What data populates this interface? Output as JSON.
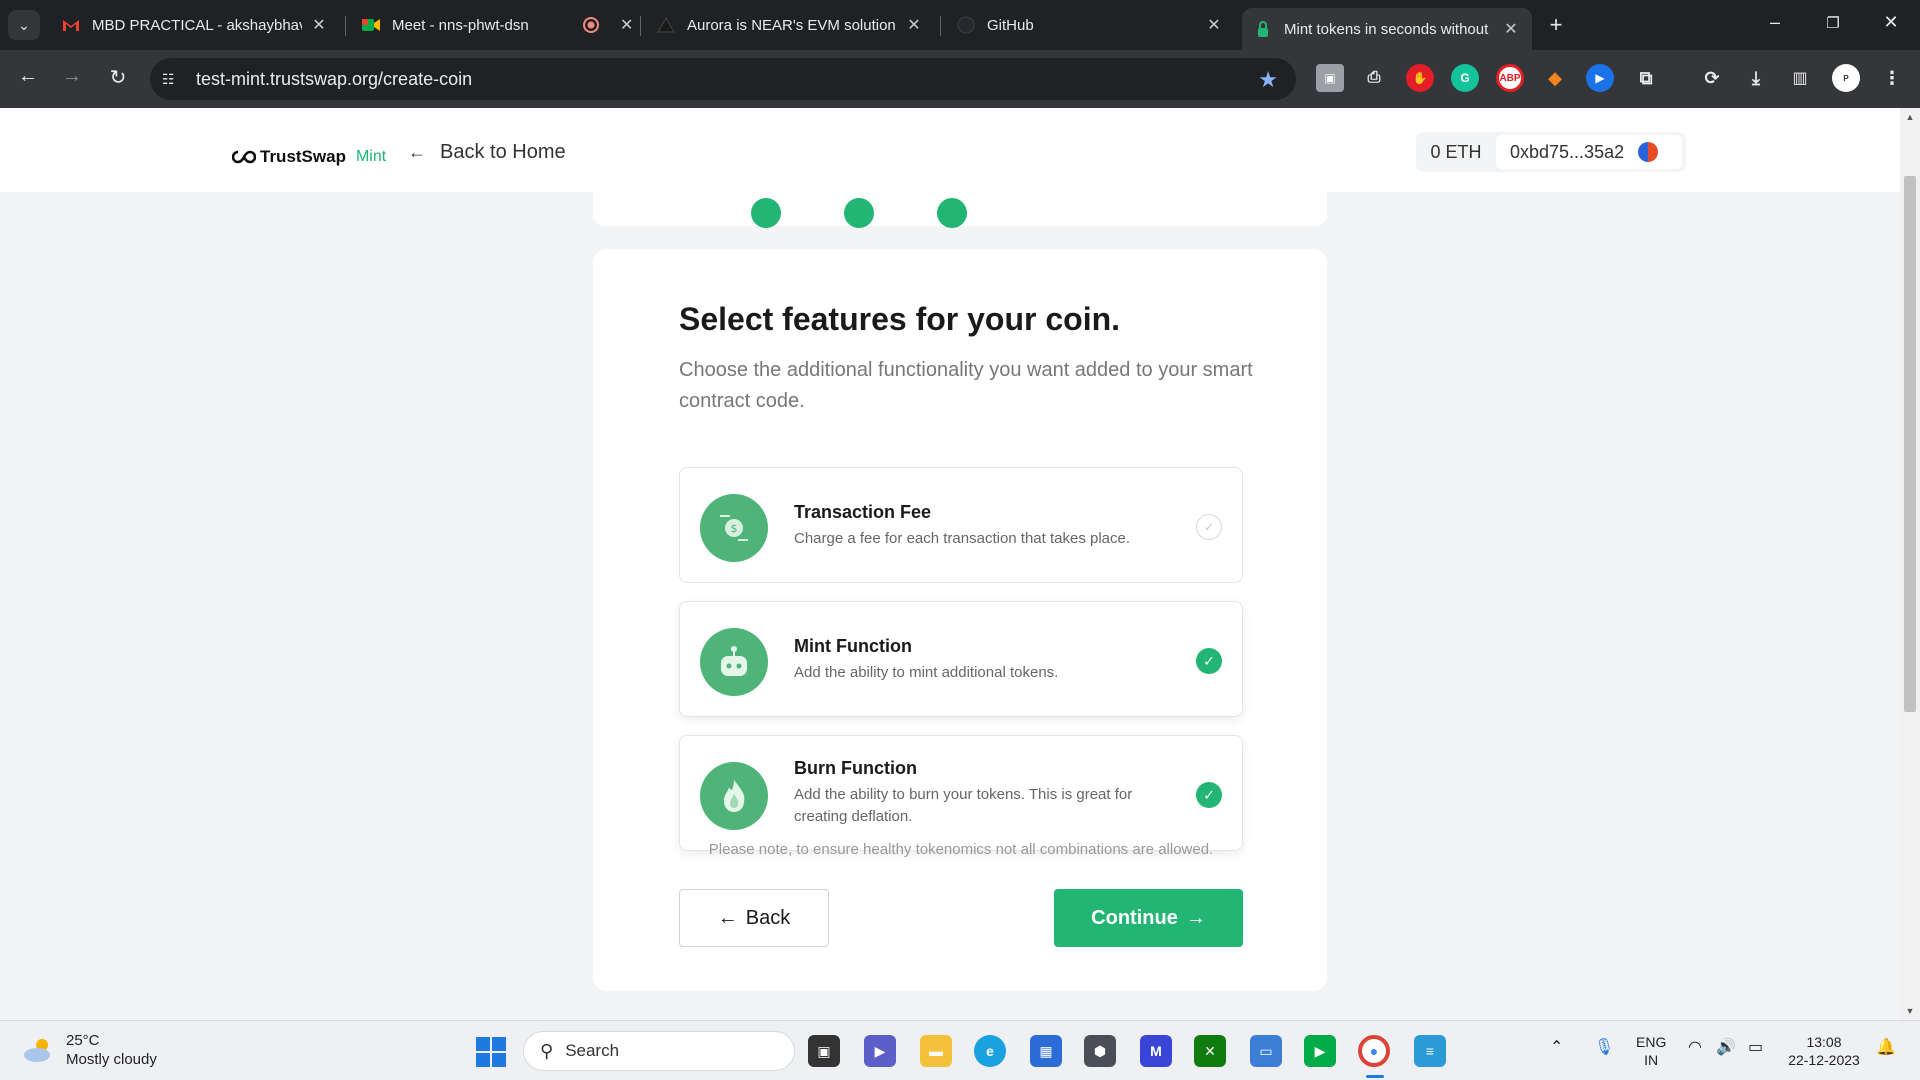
{
  "browser": {
    "tabs": [
      {
        "title": "MBD PRACTICAL - akshaybhavs",
        "favicon": "gmail-icon",
        "active": false
      },
      {
        "title": "Meet - nns-phwt-dsn",
        "favicon": "meet-icon",
        "active": false
      },
      {
        "title": "",
        "favicon": "record-icon",
        "active": false
      },
      {
        "title": "Aurora is NEAR's EVM solution",
        "favicon": "aurora-icon",
        "active": false
      },
      {
        "title": "GitHub",
        "favicon": "github-icon",
        "active": false
      },
      {
        "title": "Mint tokens in seconds without",
        "favicon": "trustswap-icon",
        "active": true
      }
    ],
    "url": "test-mint.trustswap.org/create-coin"
  },
  "header": {
    "logo_text": "TrustSwap",
    "logo_suffix": "Mint",
    "back_link": "Back to Home",
    "wallet": {
      "balance": "0 ETH",
      "address": "0xbd75...35a2"
    }
  },
  "main": {
    "title": "Select features for your coin.",
    "subtitle": "Choose the additional functionality you want added to your smart contract code.",
    "features": [
      {
        "title": "Transaction Fee",
        "description": "Charge a fee for each transaction that takes place.",
        "selected": false,
        "icon": "coin-fee-icon"
      },
      {
        "title": "Mint Function",
        "description": "Add the ability to mint additional tokens.",
        "selected": true,
        "icon": "robot-icon"
      },
      {
        "title": "Burn Function",
        "description": "Add the ability to burn your tokens. This is great for creating deflation.",
        "selected": true,
        "icon": "flame-icon"
      }
    ],
    "note": "Please note, to ensure healthy tokenomics not all combinations are allowed.",
    "back_label": "Back",
    "continue_label": "Continue"
  },
  "taskbar": {
    "weather_temp": "25°C",
    "weather_desc": "Mostly cloudy",
    "search_placeholder": "Search",
    "lang_top": "ENG",
    "lang_bottom": "IN",
    "time": "13:08",
    "date": "22-12-2023"
  },
  "colors": {
    "accent": "#22b573",
    "browser_dark": "#202124",
    "toolbar": "#35363a"
  }
}
